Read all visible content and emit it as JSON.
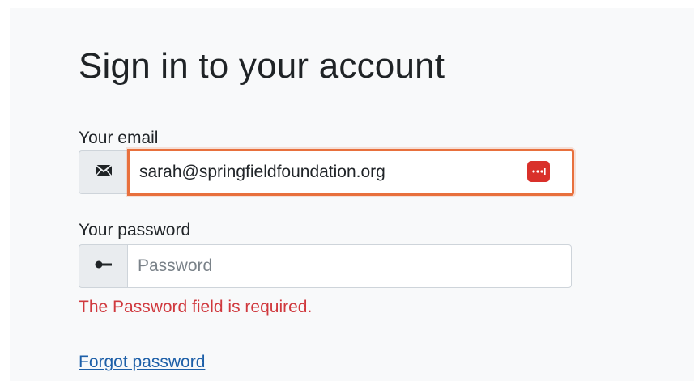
{
  "form": {
    "title": "Sign in to your account",
    "email": {
      "label": "Your email",
      "value": "sarah@springfieldfoundation.org",
      "icon": "envelope-icon"
    },
    "password": {
      "label": "Your password",
      "value": "",
      "placeholder": "Password",
      "icon": "key-icon",
      "error": "The Password field is required."
    },
    "forgot_password_label": "Forgot password"
  },
  "password_manager": {
    "icon": "password-manager-icon",
    "color": "#d9302a"
  },
  "colors": {
    "focus_border": "#e8703d",
    "error_text": "#d0393e",
    "link": "#1d5fa8",
    "addon_background": "#e9ecef",
    "card_background": "#f8f9fa"
  }
}
